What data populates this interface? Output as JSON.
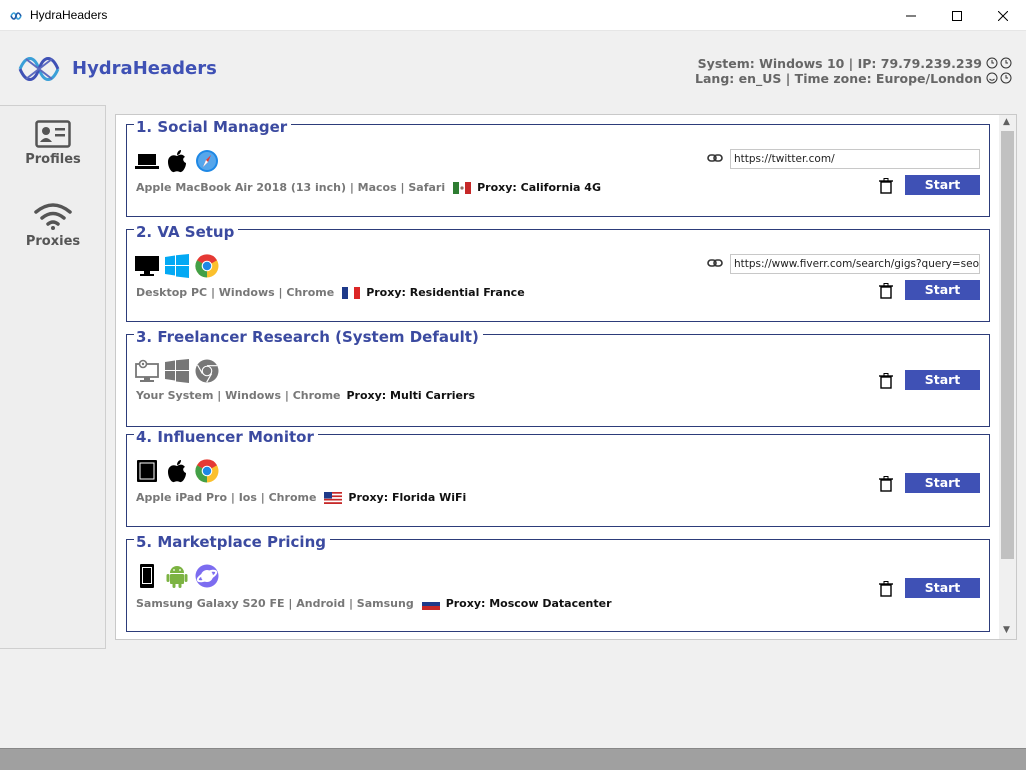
{
  "window": {
    "title": "HydraHeaders",
    "controls": [
      "minimize-icon",
      "maximize-icon",
      "close-icon"
    ]
  },
  "header": {
    "app_name": "HydraHeaders",
    "system_line": "System: Windows 10  |  IP: 79.79.239.239",
    "locale_line": "Lang: en_US  |  Time zone: Europe/London"
  },
  "sidebar": {
    "items": [
      {
        "label": "Profiles",
        "icon": "contact-card-icon"
      },
      {
        "label": "Proxies",
        "icon": "wifi-icon"
      }
    ]
  },
  "profiles": [
    {
      "title": "1. Social Manager",
      "device": "Apple MacBook Air 2018 (13 inch)",
      "os": "Macos",
      "browser": "Safari",
      "flag": "mexico",
      "proxy": "Proxy: California 4G",
      "url": "https://twitter.com/",
      "start_label": "Start",
      "icons": [
        "laptop-icon",
        "apple-icon",
        "safari-icon"
      ]
    },
    {
      "title": "2. VA Setup",
      "device": "Desktop PC",
      "os": "Windows",
      "browser": "Chrome",
      "flag": "france",
      "proxy": "Proxy: Residential France",
      "url": "https://www.fiverr.com/search/gigs?query=seo",
      "start_label": "Start",
      "icons": [
        "monitor-icon",
        "windows-icon",
        "chrome-icon"
      ]
    },
    {
      "title": "3. Freelancer Research (System Default)",
      "device": "Your System",
      "os": "Windows",
      "browser": "Chrome",
      "flag": "",
      "proxy": "Proxy: Multi Carriers",
      "url": "",
      "start_label": "Start",
      "icons": [
        "system-monitor-icon",
        "windows-icon",
        "chrome-icon"
      ]
    },
    {
      "title": "4. Influencer Monitor",
      "device": "Apple iPad Pro",
      "os": "Ios",
      "browser": "Chrome",
      "flag": "usa",
      "proxy": "Proxy: Florida WiFi",
      "url": "",
      "start_label": "Start",
      "icons": [
        "tablet-icon",
        "apple-icon",
        "chrome-icon"
      ]
    },
    {
      "title": "5. Marketplace Pricing",
      "device": "Samsung Galaxy S20 FE",
      "os": "Android",
      "browser": "Samsung",
      "flag": "russia",
      "proxy": "Proxy: Moscow Datacenter",
      "url": "",
      "start_label": "Start",
      "icons": [
        "phone-icon",
        "android-icon",
        "samsung-browser-icon"
      ]
    }
  ],
  "colors": {
    "accent": "#3f51b5",
    "card_border": "#2d3c7a",
    "title": "#3b4aa0"
  }
}
